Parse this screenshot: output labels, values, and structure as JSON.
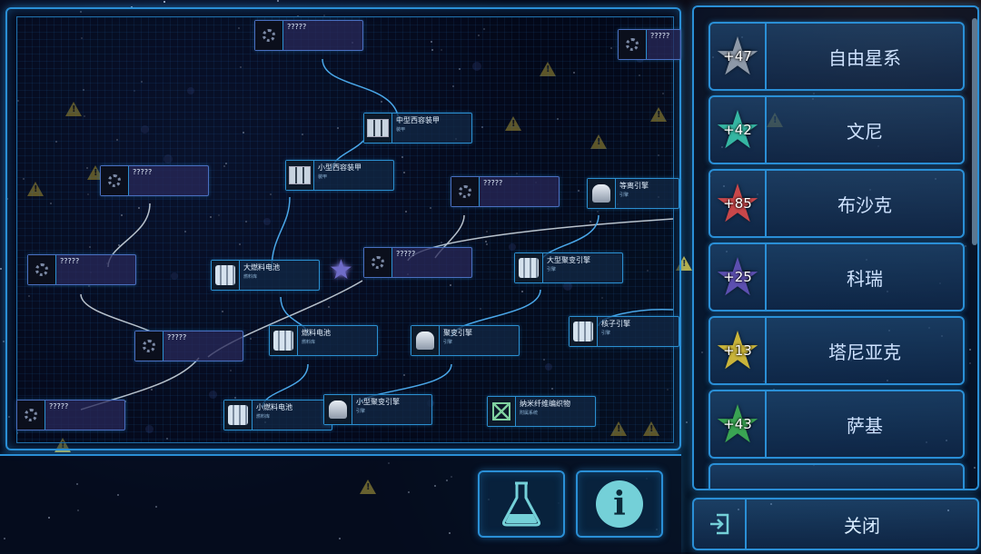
{
  "tree": {
    "nodes": [
      {
        "name": "?????",
        "sub": ""
      },
      {
        "name": "?????",
        "sub": ""
      },
      {
        "name": "中型西容装甲",
        "sub": "装甲"
      },
      {
        "name": "?????",
        "sub": ""
      },
      {
        "name": "小型西容装甲",
        "sub": "装甲"
      },
      {
        "name": "?????",
        "sub": ""
      },
      {
        "name": "等离引擎",
        "sub": "引擎"
      },
      {
        "name": "?????",
        "sub": ""
      },
      {
        "name": "大燃料电池",
        "sub": "燃料库"
      },
      {
        "name": "?????",
        "sub": ""
      },
      {
        "name": "大型聚变引擎",
        "sub": "引擎"
      },
      {
        "name": "?????",
        "sub": ""
      },
      {
        "name": "燃料电池",
        "sub": "燃料库"
      },
      {
        "name": "聚变引擎",
        "sub": "引擎"
      },
      {
        "name": "核子引擎",
        "sub": "引擎"
      },
      {
        "name": "?????",
        "sub": ""
      },
      {
        "name": "小燃料电池",
        "sub": "燃料库"
      },
      {
        "name": "小型聚变引擎",
        "sub": "引擎"
      },
      {
        "name": "纳米纤维编织物",
        "sub": "附属系统"
      }
    ]
  },
  "toolbar": {
    "research_icon": "flask-icon",
    "info_icon": "info-icon",
    "info_glyph": "i"
  },
  "factions": [
    {
      "score": "+47",
      "name": "自由星系",
      "color": "#8e99a8"
    },
    {
      "score": "+42",
      "name": "文尼",
      "color": "#35b6a2"
    },
    {
      "score": "+85",
      "name": "布沙克",
      "color": "#c8474a"
    },
    {
      "score": "+25",
      "name": "科瑞",
      "color": "#5c4fb0"
    },
    {
      "score": "+13",
      "name": "塔尼亚克",
      "color": "#c9b43a"
    },
    {
      "score": "+43",
      "name": "萨基",
      "color": "#3aa453"
    }
  ],
  "close": {
    "label": "关闭",
    "icon": "exit-icon"
  }
}
